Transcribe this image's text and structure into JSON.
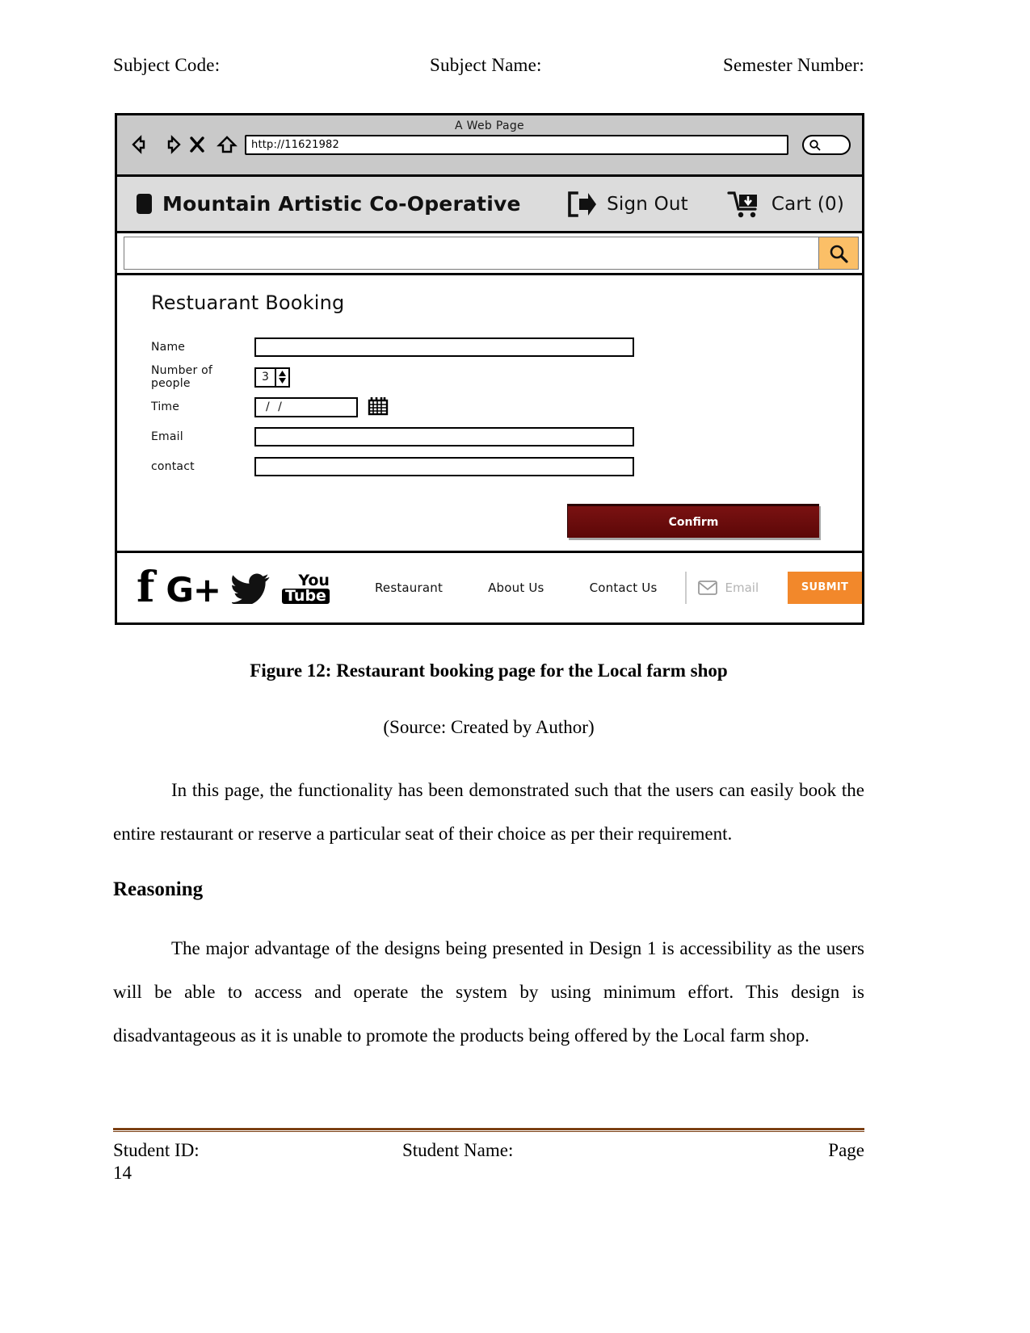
{
  "doc_header": {
    "subject_code": "Subject Code:",
    "subject_name": "Subject Name:",
    "semester_number": "Semester Number:"
  },
  "wireframe": {
    "browser": {
      "window_title": "A Web Page",
      "url_value": "http://11621982",
      "nav_icons": [
        "back-arrow-icon",
        "forward-arrow-icon",
        "stop-x-icon",
        "home-icon"
      ],
      "search_icon": "magnifier-icon"
    },
    "site_header": {
      "logo": "square-logo-icon",
      "brand_name": "Mountain Artistic Co-Operative",
      "sign_out_label": "Sign Out",
      "sign_out_icon": "sign-out-icon",
      "cart_label": "Cart (0)",
      "cart_icon": "shopping-cart-icon"
    },
    "search_bar": {
      "value": "",
      "placeholder": "",
      "button_icon": "search-icon",
      "button_color": "#fbbf67"
    },
    "form": {
      "title": "Restuarant Booking",
      "fields": [
        {
          "label": "Name",
          "value": "",
          "type": "text"
        },
        {
          "label": "Number of people",
          "value": "3",
          "type": "stepper"
        },
        {
          "label": "Time",
          "value": "/  /",
          "type": "date",
          "icon": "calendar-icon"
        },
        {
          "label": "Email",
          "value": "",
          "type": "text"
        },
        {
          "label": "contact",
          "value": "",
          "type": "text"
        }
      ],
      "confirm_label": "Confirm",
      "confirm_color": "#6d0d0d"
    },
    "footer": {
      "social": [
        {
          "name": "facebook-icon",
          "glyph": "f"
        },
        {
          "name": "google-plus-icon",
          "glyph": "G+"
        },
        {
          "name": "twitter-icon",
          "glyph": "twitter-bird"
        },
        {
          "name": "youtube-icon",
          "you": "You",
          "tube": "Tube"
        }
      ],
      "links": [
        "Restaurant",
        "About Us",
        "Contact Us"
      ],
      "newsletter": {
        "icon": "envelope-icon",
        "placeholder": "Email",
        "submit_label": "SUBMIT",
        "submit_color": "#f2882b"
      }
    }
  },
  "caption": "Figure 12: Restaurant booking page for the Local farm shop",
  "source": "(Source: Created by Author)",
  "paragraphs": {
    "p1": "In this page, the functionality has been demonstrated such that the users can easily book the entire restaurant or reserve a particular seat of their choice as per their requirement.",
    "reasoning_heading": "Reasoning",
    "p2": "The major advantage of the designs being presented in Design 1 is accessibility as the users will be able to access and operate the system by using minimum effort. This design is disadvantageous as it is unable to promote the products being offered by the Local farm shop."
  },
  "doc_footer": {
    "student_id": "Student ID:",
    "student_name": "Student Name:",
    "page_label": "Page",
    "page_number": "14"
  }
}
